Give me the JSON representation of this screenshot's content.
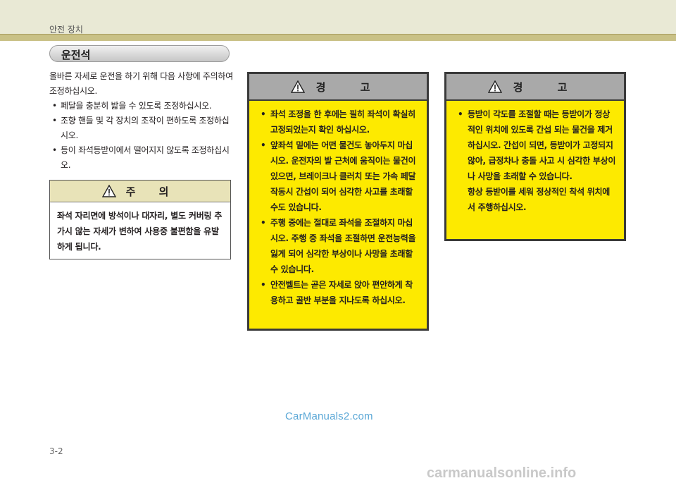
{
  "header": {
    "title": "안전 장치"
  },
  "section": {
    "title": "운전석"
  },
  "intro": {
    "text": "올바른 자세로 운전을 하기 위해 다음 사항에 주의하여 조정하십시오.",
    "bullets": [
      "페달을 충분히 밟을 수 있도록 조정하십시오.",
      "조향 핸들 및 각 장치의 조작이 편하도록 조정하십시오.",
      "등이 좌석등받이에서 떨어지지 않도록 조정하십시오."
    ]
  },
  "caution": {
    "title": "주 의",
    "body": "좌석 자리면에 방석이나 대자리, 별도 커버링 추가시 않는 자세가 변하여 사용중 불편함을 유발하게 됩니다."
  },
  "warning1": {
    "title": "경 고",
    "bullets": [
      "좌석 조정을 한 후에는 필히 좌석이 확실히 고정되었는지 확인 하십시오.",
      "앞좌석 밑에는 어떤 물건도 놓아두지 마십시오. 운전자의 발 근처에 움직이는 물건이 있으면, 브레이크나 클러치 또는 가속 페달 작동시 간섭이 되어 심각한 사고를 초래할 수도 있습니다.",
      "주행 중에는 절대로 좌석을 조절하지 마십시오. 주행 중 좌석을 조절하면 운전능력을 잃게 되어 심각한 부상이나 사망을 초래할 수 있습니다.",
      "안전벨트는 곧은 자세로 앉아 편안하게 착용하고 골반 부분을 지나도록 하십시오."
    ]
  },
  "warning2": {
    "title": "경 고",
    "bullets": [
      "등받이 각도를 조절할 때는 등받이가 정상적인 위치에 있도록 간섭 되는 물건을 제거 하십시오. 간섭이 되면, 등받이가 고정되지 않아, 급정차나 충돌 사고 시 심각한 부상이나 사망을 초래할 수 있습니다."
    ],
    "extra": "항상 등받이를 세워 정상적인 착석 위치에서 주행하십시오."
  },
  "watermark": "CarManuals2.com",
  "page_number": "3-2",
  "footer_watermark": "carmanualsonline.info"
}
